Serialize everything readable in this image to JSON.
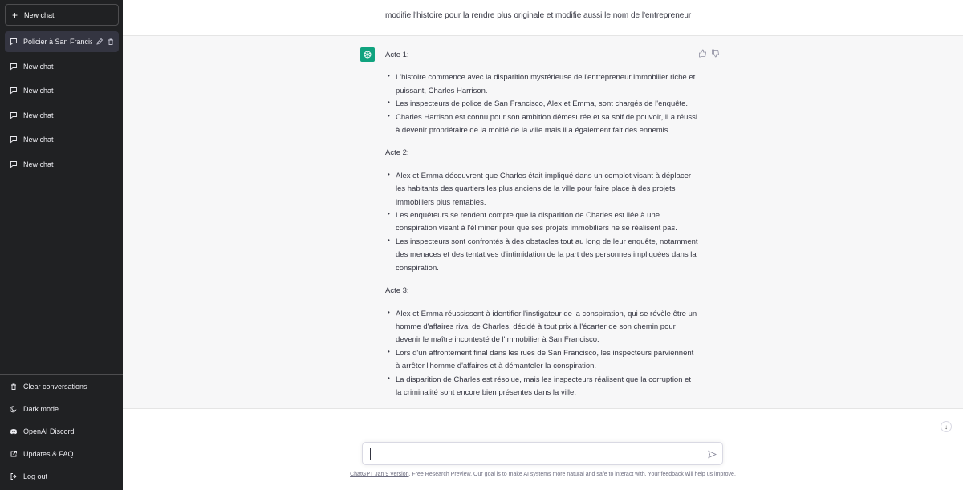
{
  "sidebar": {
    "new_chat_label": "New chat",
    "chats": [
      {
        "label": "Policier à San Francisco",
        "active": true
      },
      {
        "label": "New chat",
        "active": false
      },
      {
        "label": "New chat",
        "active": false
      },
      {
        "label": "New chat",
        "active": false
      },
      {
        "label": "New chat",
        "active": false
      },
      {
        "label": "New chat",
        "active": false
      }
    ],
    "bottom_links": [
      {
        "label": "Clear conversations",
        "icon": "trash-icon"
      },
      {
        "label": "Dark mode",
        "icon": "moon-icon"
      },
      {
        "label": "OpenAI Discord",
        "icon": "discord-icon"
      },
      {
        "label": "Updates & FAQ",
        "icon": "external-link-icon"
      },
      {
        "label": "Log out",
        "icon": "logout-icon"
      }
    ]
  },
  "conversation": {
    "user_message": "modifie l'histoire pour la rendre plus originale et modifie aussi le nom de l'entrepreneur",
    "assistant": {
      "acts": [
        {
          "title": "Acte 1:",
          "bullets": [
            "L'histoire commence avec la disparition mystérieuse de l'entrepreneur immobilier riche et puissant, Charles Harrison.",
            "Les inspecteurs de police de San Francisco, Alex et Emma, sont chargés de l'enquête.",
            "Charles Harrison est connu pour son ambition démesurée et sa soif de pouvoir, il a réussi à devenir propriétaire de la moitié de la ville mais il a également fait des ennemis."
          ]
        },
        {
          "title": "Acte 2:",
          "bullets": [
            "Alex et Emma découvrent que Charles était impliqué dans un complot visant à déplacer les habitants des quartiers les plus anciens de la ville pour faire place à des projets immobiliers plus rentables.",
            "Les enquêteurs se rendent compte que la disparition de Charles est liée à une conspiration visant à l'éliminer pour que ses projets immobiliers ne se réalisent pas.",
            "Les inspecteurs sont confrontés à des obstacles tout au long de leur enquête, notamment des menaces et des tentatives d'intimidation de la part des personnes impliquées dans la conspiration."
          ]
        },
        {
          "title": "Acte 3:",
          "bullets": [
            "Alex et Emma réussissent à identifier l'instigateur de la conspiration, qui se révèle être un homme d'affaires rival de Charles, décidé à tout prix à l'écarter de son chemin pour devenir le maître incontesté de l'immobilier à San Francisco.",
            "Lors d'un affrontement final dans les rues de San Francisco, les inspecteurs parviennent à arrêter l'homme d'affaires et à démanteler la conspiration.",
            "La disparition de Charles est résolue, mais les inspecteurs réalisent que la corruption et la criminalité sont encore bien présentes dans la ville."
          ]
        }
      ]
    }
  },
  "composer": {
    "value": "",
    "placeholder": ""
  },
  "footer": {
    "version_link": "ChatGPT Jan 9 Version",
    "text": ". Free Research Preview. Our goal is to make AI systems more natural and safe to interact with. Your feedback will help us improve."
  },
  "colors": {
    "sidebar_bg": "#202123",
    "active_chat_bg": "#343541",
    "assistant_bg": "#f7f7f8",
    "brand_green": "#10a37f"
  }
}
